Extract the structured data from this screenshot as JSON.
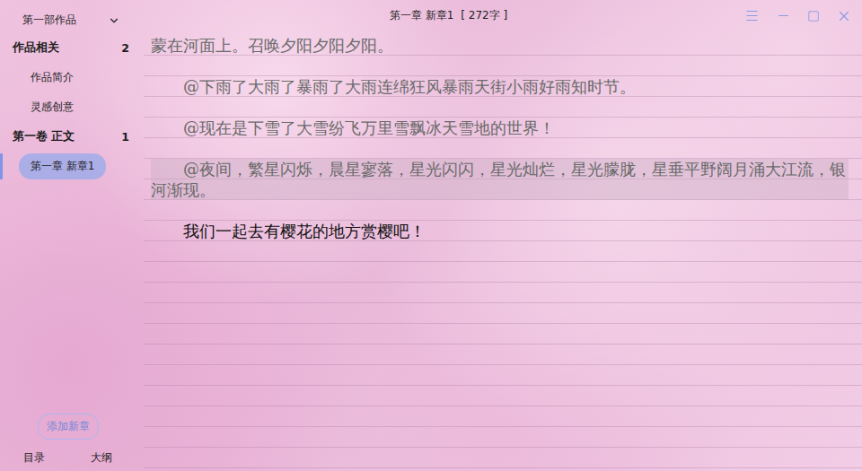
{
  "window": {
    "title": "第一章 新章1",
    "word_count": "[ 272字 ]"
  },
  "sidebar": {
    "work_selector": "第一部作品",
    "groups": [
      {
        "label": "作品相关",
        "count": "2",
        "items": [
          {
            "label": "作品简介",
            "selected": false
          },
          {
            "label": "灵感创意",
            "selected": false
          }
        ]
      },
      {
        "label": "第一卷 正文",
        "count": "1",
        "items": [
          {
            "label": "第一章 新章1",
            "selected": true
          }
        ]
      }
    ],
    "add_button": "添加新章",
    "bottom_tabs": [
      "目录",
      "大纲"
    ]
  },
  "editor": {
    "paragraphs": [
      {
        "kind": "continuation",
        "text": "蒙在河面上。召唤夕阳夕阳夕阳。",
        "dimmed": true,
        "highlighted": false
      },
      {
        "kind": "paragraph",
        "text": "@下雨了大雨了暴雨了大雨连绵狂风暴雨天街小雨好雨知时节。",
        "dimmed": true,
        "highlighted": false
      },
      {
        "kind": "paragraph",
        "text": "@现在是下雪了大雪纷飞万里雪飘冰天雪地的世界！",
        "dimmed": true,
        "highlighted": false
      },
      {
        "kind": "paragraph",
        "text": "@夜间，繁星闪烁，晨星寥落，星光闪闪，星光灿烂，星光朦胧，星垂平野阔月涌大江流，银河渐现。",
        "dimmed": true,
        "highlighted": true
      },
      {
        "kind": "paragraph",
        "text": "我们一起去有樱花的地方赏樱吧！",
        "dimmed": false,
        "highlighted": false
      }
    ]
  }
}
